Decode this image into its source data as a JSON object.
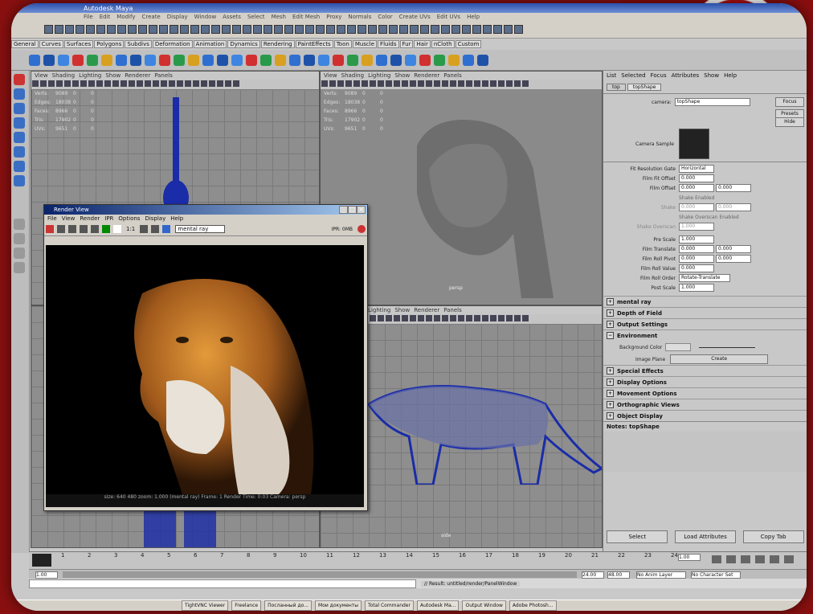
{
  "app": {
    "title": "Autodesk Maya",
    "menus": [
      "File",
      "Edit",
      "Modify",
      "Create",
      "Display",
      "Window",
      "Assets",
      "Select",
      "Mesh",
      "Edit Mesh",
      "Proxy",
      "Normals",
      "Color",
      "Create UVs",
      "Edit UVs",
      "Help"
    ]
  },
  "shelf_tabs": [
    "General",
    "Curves",
    "Surfaces",
    "Polygons",
    "Subdivs",
    "Deformation",
    "Animation",
    "Dynamics",
    "Rendering",
    "PaintEffects",
    "Toon",
    "Muscle",
    "Fluids",
    "Fur",
    "Hair",
    "nCloth",
    "Custom"
  ],
  "viewport_menu": [
    "View",
    "Shading",
    "Lighting",
    "Show",
    "Renderer",
    "Panels"
  ],
  "hud": [
    {
      "label": "Verts:",
      "v": "9089",
      "a": "0",
      "b": "0"
    },
    {
      "label": "Edges:",
      "v": "18038",
      "a": "0",
      "b": "0"
    },
    {
      "label": "Faces:",
      "v": "8966",
      "a": "0",
      "b": "0"
    },
    {
      "label": "Tris:",
      "v": "17902",
      "a": "0",
      "b": "0"
    },
    {
      "label": "UVs:",
      "v": "9651",
      "a": "0",
      "b": "0"
    }
  ],
  "persp_label": "persp",
  "side_label": "side",
  "render_view": {
    "title": "Render View",
    "menus": [
      "File",
      "View",
      "Render",
      "IPR",
      "Options",
      "Display",
      "Help"
    ],
    "zoom": "1:1",
    "renderer": "mental ray",
    "ipr": "IPR: 0MB",
    "status_line1": "size: 640 480 zoom: 1.000 (mental ray) Frame: 1 Render Time: 0:03 Camera: persp",
    "frame": "Frame: 1",
    "time": "Render Time: 0:03",
    "camera": "Camera: persp"
  },
  "attr_editor": {
    "menus": [
      "List",
      "Selected",
      "Focus",
      "Attributes",
      "Show",
      "Help"
    ],
    "tabs": [
      "top",
      "topShape"
    ],
    "camera_label": "camera:",
    "camera_value": "topShape",
    "focus": "Focus",
    "presets": "Presets",
    "hide": "Hide",
    "camera_sample": "Camera Sample",
    "fit_res_gate": "Fit Resolution Gate",
    "fit_res_gate_value": "Horizontal",
    "film_fit_offset": "Film Fit Offset",
    "film_offset": "Film Offset",
    "shake_enabled": "Shake Enabled",
    "shake": "Shake",
    "shake_overscan_enabled": "Shake Overscan Enabled",
    "shake_overscan": "Shake Overscan",
    "pre_scale": "Pre Scale",
    "film_translate": "Film Translate",
    "film_roll_pivot": "Film Roll Pivot",
    "film_roll_value": "Film Roll Value",
    "film_roll_order": "Film Roll Order",
    "film_roll_order_value": "Rotate-Translate",
    "post_scale": "Post Scale",
    "zero": "0.000",
    "one": "1.000",
    "sections": [
      "mental ray",
      "Depth of Field",
      "Output Settings",
      "Environment",
      "Special Effects",
      "Display Options",
      "Movement Options",
      "Orthographic Views",
      "Object Display"
    ],
    "background_color": "Background Color",
    "image_plane": "Image Plane",
    "create": "Create",
    "notes": "Notes: topShape",
    "select": "Select",
    "load_attributes": "Load Attributes",
    "copy_tab": "Copy Tab"
  },
  "timeline": {
    "ticks": [
      "1",
      "2",
      "3",
      "4",
      "5",
      "6",
      "7",
      "8",
      "9",
      "10",
      "11",
      "12",
      "13",
      "14",
      "15",
      "16",
      "17",
      "18",
      "19",
      "20",
      "21",
      "22",
      "23",
      "24"
    ],
    "current": "1.00"
  },
  "range": {
    "start": "1.00",
    "end": "24.00",
    "end2": "48.00",
    "anim_layer": "No Anim Layer",
    "char_set": "No Character Set"
  },
  "cmdline": "// Result: untitled/render/PanelWindow",
  "taskbar": [
    "TightVNC Viewer",
    "Freelance",
    "Посланный до...",
    "Мои документы",
    "Total Commander",
    "Autodesk Ma...",
    "Output Window",
    "Adobe Photosh..."
  ]
}
